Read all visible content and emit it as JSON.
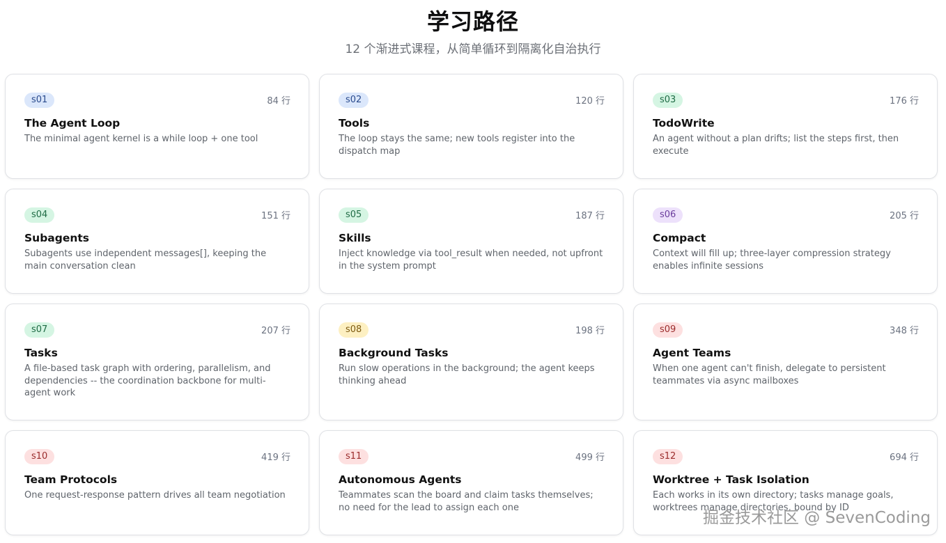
{
  "header": {
    "title": "学习路径",
    "subtitle": "12 个渐进式课程，从简单循环到隔离化自治执行"
  },
  "cards": [
    {
      "badge": "s01",
      "lines": "84 行",
      "title": "The Agent Loop",
      "desc": "The minimal agent kernel is a while loop + one tool",
      "badge_bg": "#dbe7fb",
      "badge_fg": "#2a4b8d"
    },
    {
      "badge": "s02",
      "lines": "120 行",
      "title": "Tools",
      "desc": "The loop stays the same; new tools register into the dispatch map",
      "badge_bg": "#dbe7fb",
      "badge_fg": "#2a4b8d"
    },
    {
      "badge": "s03",
      "lines": "176 行",
      "title": "TodoWrite",
      "desc": "An agent without a plan drifts; list the steps first, then execute",
      "badge_bg": "#d5f5e3",
      "badge_fg": "#1f6b45"
    },
    {
      "badge": "s04",
      "lines": "151 行",
      "title": "Subagents",
      "desc": "Subagents use independent messages[], keeping the main conversation clean",
      "badge_bg": "#d5f5e3",
      "badge_fg": "#1f6b45"
    },
    {
      "badge": "s05",
      "lines": "187 行",
      "title": "Skills",
      "desc": "Inject knowledge via tool_result when needed, not upfront in the system prompt",
      "badge_bg": "#d5f5e3",
      "badge_fg": "#1f6b45"
    },
    {
      "badge": "s06",
      "lines": "205 行",
      "title": "Compact",
      "desc": "Context will fill up; three-layer compression strategy enables infinite sessions",
      "badge_bg": "#ede1fb",
      "badge_fg": "#6a3c9c"
    },
    {
      "badge": "s07",
      "lines": "207 行",
      "title": "Tasks",
      "desc": "A file-based task graph with ordering, parallelism, and dependencies -- the coordination backbone for multi-agent work",
      "badge_bg": "#d5f5e3",
      "badge_fg": "#1f6b45"
    },
    {
      "badge": "s08",
      "lines": "198 行",
      "title": "Background Tasks",
      "desc": "Run slow operations in the background; the agent keeps thinking ahead",
      "badge_bg": "#fdf0c2",
      "badge_fg": "#7d5a10"
    },
    {
      "badge": "s09",
      "lines": "348 行",
      "title": "Agent Teams",
      "desc": "When one agent can't finish, delegate to persistent teammates via async mailboxes",
      "badge_bg": "#fde0e0",
      "badge_fg": "#9b2c2c"
    },
    {
      "badge": "s10",
      "lines": "419 行",
      "title": "Team Protocols",
      "desc": "One request-response pattern drives all team negotiation",
      "badge_bg": "#fde0e0",
      "badge_fg": "#9b2c2c"
    },
    {
      "badge": "s11",
      "lines": "499 行",
      "title": "Autonomous Agents",
      "desc": "Teammates scan the board and claim tasks themselves; no need for the lead to assign each one",
      "badge_bg": "#fde0e0",
      "badge_fg": "#9b2c2c"
    },
    {
      "badge": "s12",
      "lines": "694 行",
      "title": "Worktree + Task Isolation",
      "desc": "Each works in its own directory; tasks manage goals, worktrees manage directories, bound by ID",
      "badge_bg": "#fde0e0",
      "badge_fg": "#9b2c2c"
    }
  ],
  "watermark": "掘金技术社区 @ SevenCoding"
}
